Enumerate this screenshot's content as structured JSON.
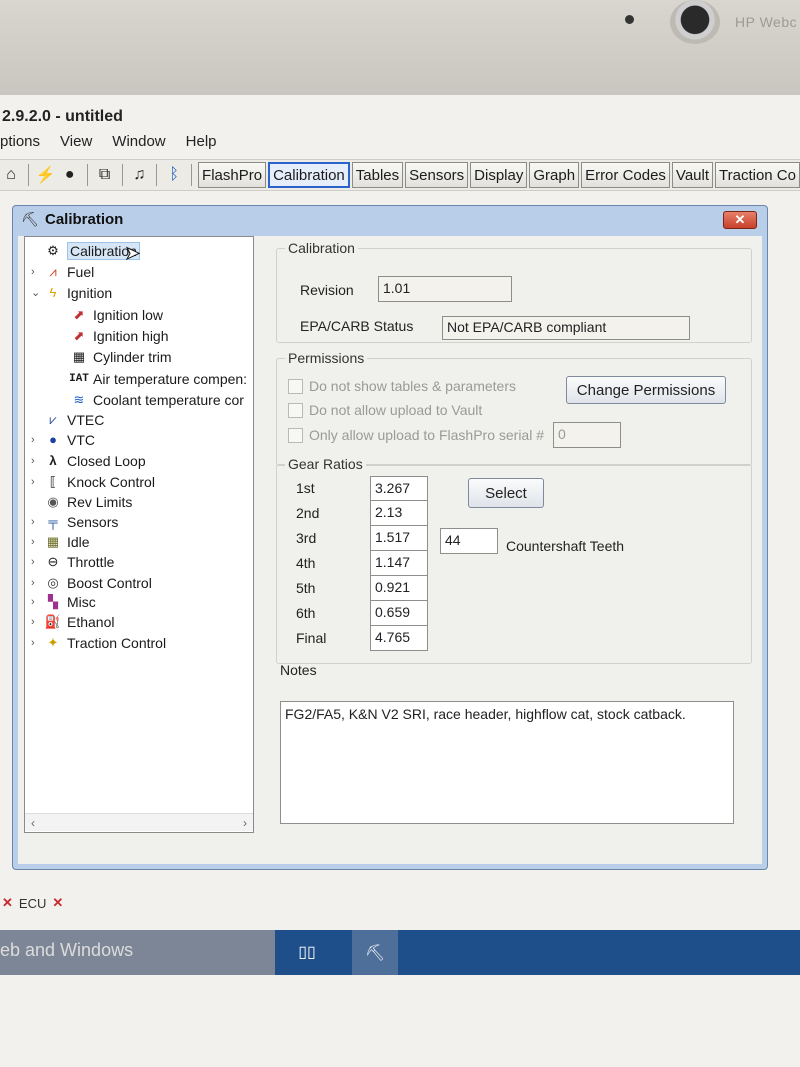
{
  "bezel": {
    "brand": "HP Webc"
  },
  "app": {
    "title": "2.9.2.0 - untitled"
  },
  "menu": [
    "ptions",
    "View",
    "Window",
    "Help"
  ],
  "toolbar": {
    "buttons": [
      "FlashPro",
      "Calibration",
      "Tables",
      "Sensors",
      "Display",
      "Graph",
      "Error Codes",
      "Vault",
      "Traction Co"
    ],
    "active": "Calibration"
  },
  "window": {
    "title": "Calibration",
    "close": "✕"
  },
  "tree": {
    "items": [
      {
        "label": "Calibration",
        "icon": "calibration-icon"
      },
      {
        "label": "Fuel",
        "icon": "fuel-icon"
      },
      {
        "label": "Ignition",
        "icon": "ignition-icon"
      },
      {
        "label": "Ignition low",
        "icon": "ignition-map-icon"
      },
      {
        "label": "Ignition high",
        "icon": "ignition-map-icon"
      },
      {
        "label": "Cylinder trim",
        "icon": "cylinder-icon"
      },
      {
        "label": "Air temperature compen:",
        "icon": "iat-icon",
        "icon_text": "IAT"
      },
      {
        "label": "Coolant temperature cor",
        "icon": "coolant-icon"
      },
      {
        "label": "VTEC",
        "icon": "vtec-icon"
      },
      {
        "label": "VTC",
        "icon": "vtc-icon"
      },
      {
        "label": "Closed Loop",
        "icon": "lambda-icon"
      },
      {
        "label": "Knock Control",
        "icon": "knock-icon"
      },
      {
        "label": "Rev Limits",
        "icon": "rev-limit-icon"
      },
      {
        "label": "Sensors",
        "icon": "sensor-icon"
      },
      {
        "label": "Idle",
        "icon": "idle-icon"
      },
      {
        "label": "Throttle",
        "icon": "throttle-icon"
      },
      {
        "label": "Boost Control",
        "icon": "boost-icon"
      },
      {
        "label": "Misc",
        "icon": "misc-icon"
      },
      {
        "label": "Ethanol",
        "icon": "ethanol-icon"
      },
      {
        "label": "Traction Control",
        "icon": "traction-icon"
      }
    ]
  },
  "calibration": {
    "group_label": "Calibration",
    "revision_label": "Revision",
    "revision_value": "1.01",
    "epa_label": "EPA/CARB Status",
    "epa_value": "Not EPA/CARB compliant"
  },
  "permissions": {
    "group_label": "Permissions",
    "opt1": "Do not show tables & parameters",
    "opt2": "Do not allow upload to Vault",
    "opt3": "Only allow upload to FlashPro serial #",
    "serial_value": "0",
    "change_button": "Change Permissions"
  },
  "gear_ratios": {
    "group_label": "Gear Ratios",
    "rows": [
      {
        "label": "1st",
        "value": "3.267"
      },
      {
        "label": "2nd",
        "value": "2.13"
      },
      {
        "label": "3rd",
        "value": "1.517"
      },
      {
        "label": "4th",
        "value": "1.147"
      },
      {
        "label": "5th",
        "value": "0.921"
      },
      {
        "label": "6th",
        "value": "0.659"
      },
      {
        "label": "Final",
        "value": "4.765"
      }
    ],
    "select_button": "Select",
    "countershaft_value": "44",
    "countershaft_label": "Countershaft Teeth"
  },
  "notes": {
    "label": "Notes",
    "text": "FG2/FA5, K&N V2 SRI, race header, highflow cat, stock catback."
  },
  "status": {
    "ecu_label": "ECU"
  },
  "taskbar": {
    "search_text": "eb and Windows"
  }
}
